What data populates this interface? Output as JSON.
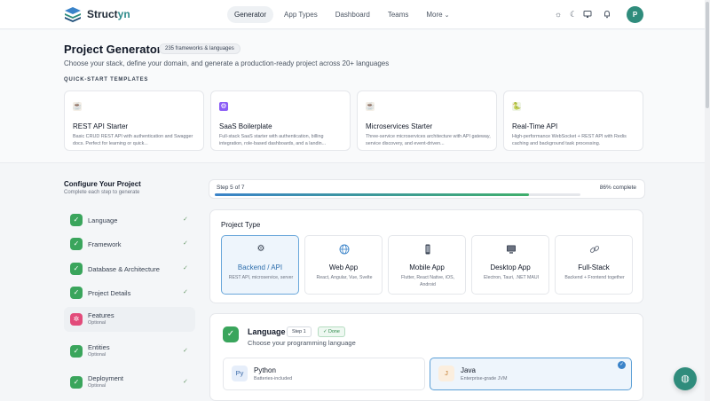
{
  "app": {
    "brand_main": "Struct",
    "brand_accent": "yn",
    "brand_color": "#2d8a8a"
  },
  "nav": {
    "items": [
      {
        "label": "Generator",
        "active": true
      },
      {
        "label": "App Types"
      },
      {
        "label": "Dashboard"
      },
      {
        "label": "Teams"
      },
      {
        "label": "More"
      }
    ]
  },
  "toolbar": {
    "icons": [
      "sun-icon",
      "moon-icon",
      "monitor-icon",
      "bell-icon"
    ],
    "avatar_initial": "P"
  },
  "header": {
    "title": "Project Generator",
    "count_badge": "235 frameworks & languages",
    "subtitle": "Choose your stack, define your domain, and generate a production-ready project across 20+ languages"
  },
  "quickstart": {
    "label": "QUICK-START TEMPLATES",
    "templates": [
      {
        "title": "REST API Starter",
        "desc": "Basic CRUD REST API with authentication and Swagger docs. Perfect for learning or quick...",
        "icon": "coffee-icon"
      },
      {
        "title": "SaaS Boilerplate",
        "desc": "Full-stack SaaS starter with authentication, billing integration, role-based dashboards, and a landin...",
        "icon": "gear-icon"
      },
      {
        "title": "Microservices Starter",
        "desc": "Three-service microservices architecture with API gateway, service discovery, and event-driven...",
        "icon": "coffee-icon"
      },
      {
        "title": "Real-Time API",
        "desc": "High-performance WebSocket + REST API with Redis caching and background task processing.",
        "icon": "python-icon"
      }
    ]
  },
  "sidebar": {
    "title": "Configure Your Project",
    "subtitle": "Complete each step to generate",
    "steps": [
      {
        "label": "Language",
        "status": "done"
      },
      {
        "label": "Framework",
        "status": "done"
      },
      {
        "label": "Database & Architecture",
        "status": "done"
      },
      {
        "label": "Project Details",
        "status": "done"
      },
      {
        "label": "Features",
        "optional": "Optional",
        "status": "active"
      },
      {
        "label": "Entities",
        "optional": "Optional",
        "status": "done"
      },
      {
        "label": "Deployment",
        "optional": "Optional",
        "status": "done"
      }
    ]
  },
  "progress": {
    "step_text": "Step 5 of 7",
    "percent_text": "86% complete",
    "value": 0.86
  },
  "project_type": {
    "title": "Project Type",
    "options": [
      {
        "name": "Backend / API",
        "desc": "REST API, microservice, server",
        "icon": "gear-icon",
        "selected": true
      },
      {
        "name": "Web App",
        "desc": "React, Angular, Vue, Svelte",
        "icon": "globe-icon"
      },
      {
        "name": "Mobile App",
        "desc": "Flutter, React Native, iOS, Android",
        "icon": "phone-icon"
      },
      {
        "name": "Desktop App",
        "desc": "Electron, Tauri, .NET MAUI",
        "icon": "desktop-icon"
      },
      {
        "name": "Full-Stack",
        "desc": "Backend + Frontend together",
        "icon": "link-icon"
      }
    ]
  },
  "language": {
    "title": "Language",
    "step_badge": "Step 1",
    "done_badge": "✓ Done",
    "subtitle": "Choose your programming language",
    "options": [
      {
        "mono": "Py",
        "name": "Python",
        "desc": "Batteries-included",
        "mono_bg": "#e6eefa",
        "mono_color": "#3b6aa8"
      },
      {
        "mono": "J",
        "name": "Java",
        "desc": "Enterprise-grade JVM",
        "mono_bg": "#fbeede",
        "mono_color": "#c27a2b",
        "selected": true
      }
    ]
  }
}
